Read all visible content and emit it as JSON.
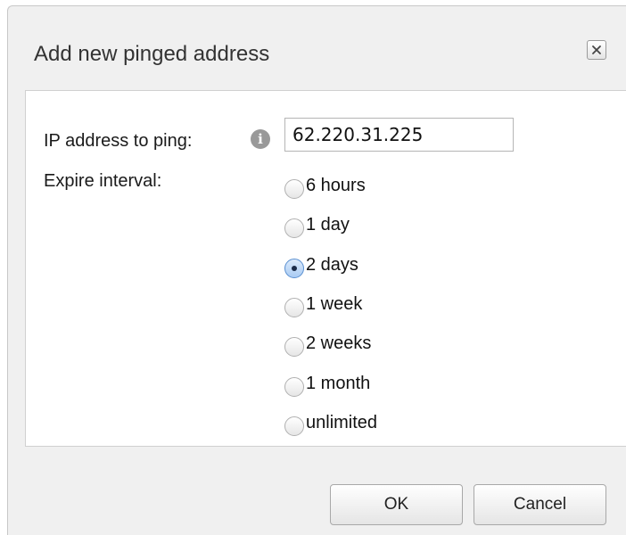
{
  "dialog": {
    "title": "Add new pinged address",
    "close_icon": "close-icon"
  },
  "form": {
    "ip_label": "IP address to ping:",
    "info_icon": "info-icon",
    "info_glyph": "i",
    "ip_value": "62.220.31.225",
    "expire_label": "Expire interval:",
    "expire_options": [
      {
        "label": "6 hours",
        "checked": false
      },
      {
        "label": "1 day",
        "checked": false
      },
      {
        "label": "2 days",
        "checked": true
      },
      {
        "label": "1 week",
        "checked": false
      },
      {
        "label": "2 weeks",
        "checked": false
      },
      {
        "label": "1 month",
        "checked": false
      },
      {
        "label": "unlimited",
        "checked": false
      }
    ],
    "selected_expire": "2 days"
  },
  "buttons": {
    "ok_label": "OK",
    "cancel_label": "Cancel"
  },
  "colors": {
    "dialog_background": "#f0f0f0",
    "content_background": "#ffffff",
    "selected_radio": "#a9cbf3"
  }
}
